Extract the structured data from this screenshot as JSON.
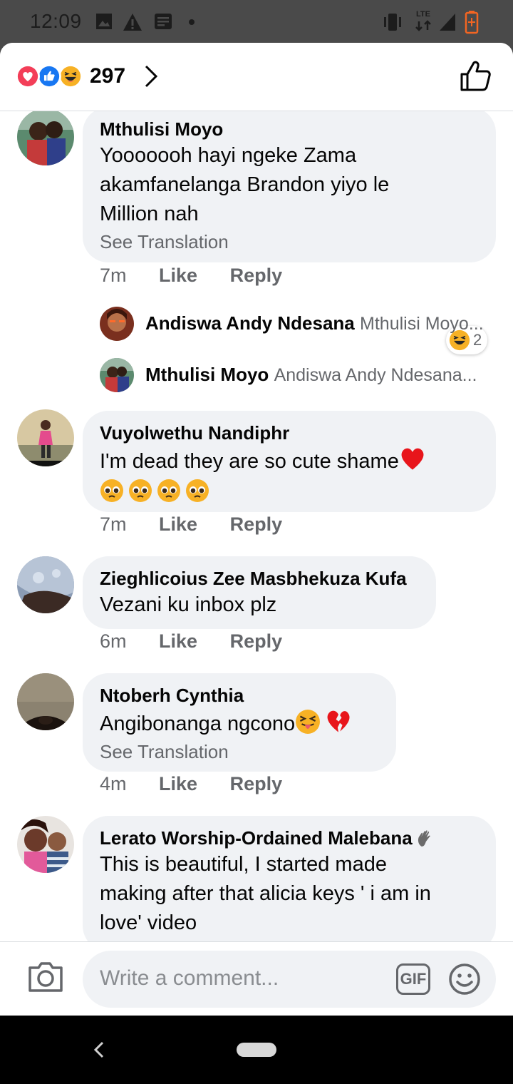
{
  "status_bar": {
    "time": "12:09",
    "network": "LTE"
  },
  "header": {
    "reaction_count": "297",
    "reactions": [
      "love",
      "like",
      "haha"
    ]
  },
  "comments": [
    {
      "name": "Mthulisi Moyo",
      "text_lines": [
        "Yooooooh hayi ngeke Zama",
        "akamfanelanga Brandon yiyo le",
        "Million nah"
      ],
      "translation": "See Translation",
      "time": "7m",
      "like": "Like",
      "reply": "Reply",
      "reaction_count": "2",
      "replies": [
        {
          "name": "Andiswa Andy Ndesana",
          "snippet": "Mthulisi Moyo..."
        },
        {
          "name": "Mthulisi Moyo",
          "snippet": "Andiswa Andy Ndesana..."
        }
      ]
    },
    {
      "name": "Vuyolwethu Nandiphr",
      "text_lines": [
        "I'm dead they are so cute shame"
      ],
      "time": "7m",
      "like": "Like",
      "reply": "Reply"
    },
    {
      "name": "Zieghlicoius Zee Masbhekuza Kufa",
      "text_lines": [
        "Vezani ku inbox plz"
      ],
      "time": "6m",
      "like": "Like",
      "reply": "Reply"
    },
    {
      "name": "Ntoberh Cynthia",
      "text_lines": [
        "Angibonanga ngcono"
      ],
      "translation": "See Translation",
      "time": "4m",
      "like": "Like",
      "reply": "Reply"
    },
    {
      "name": "Lerato Worship-Ordained Malebana",
      "text_lines": [
        "This is beautiful, I started made",
        "making after that alicia keys '  i am in",
        "love' video"
      ]
    }
  ],
  "composer": {
    "placeholder": "Write a comment...",
    "gif_label": "GIF"
  },
  "colors": {
    "bubble": "#f0f2f5",
    "meta": "#65676b",
    "like_blue": "#1877f2",
    "love_red": "#f33e58"
  }
}
